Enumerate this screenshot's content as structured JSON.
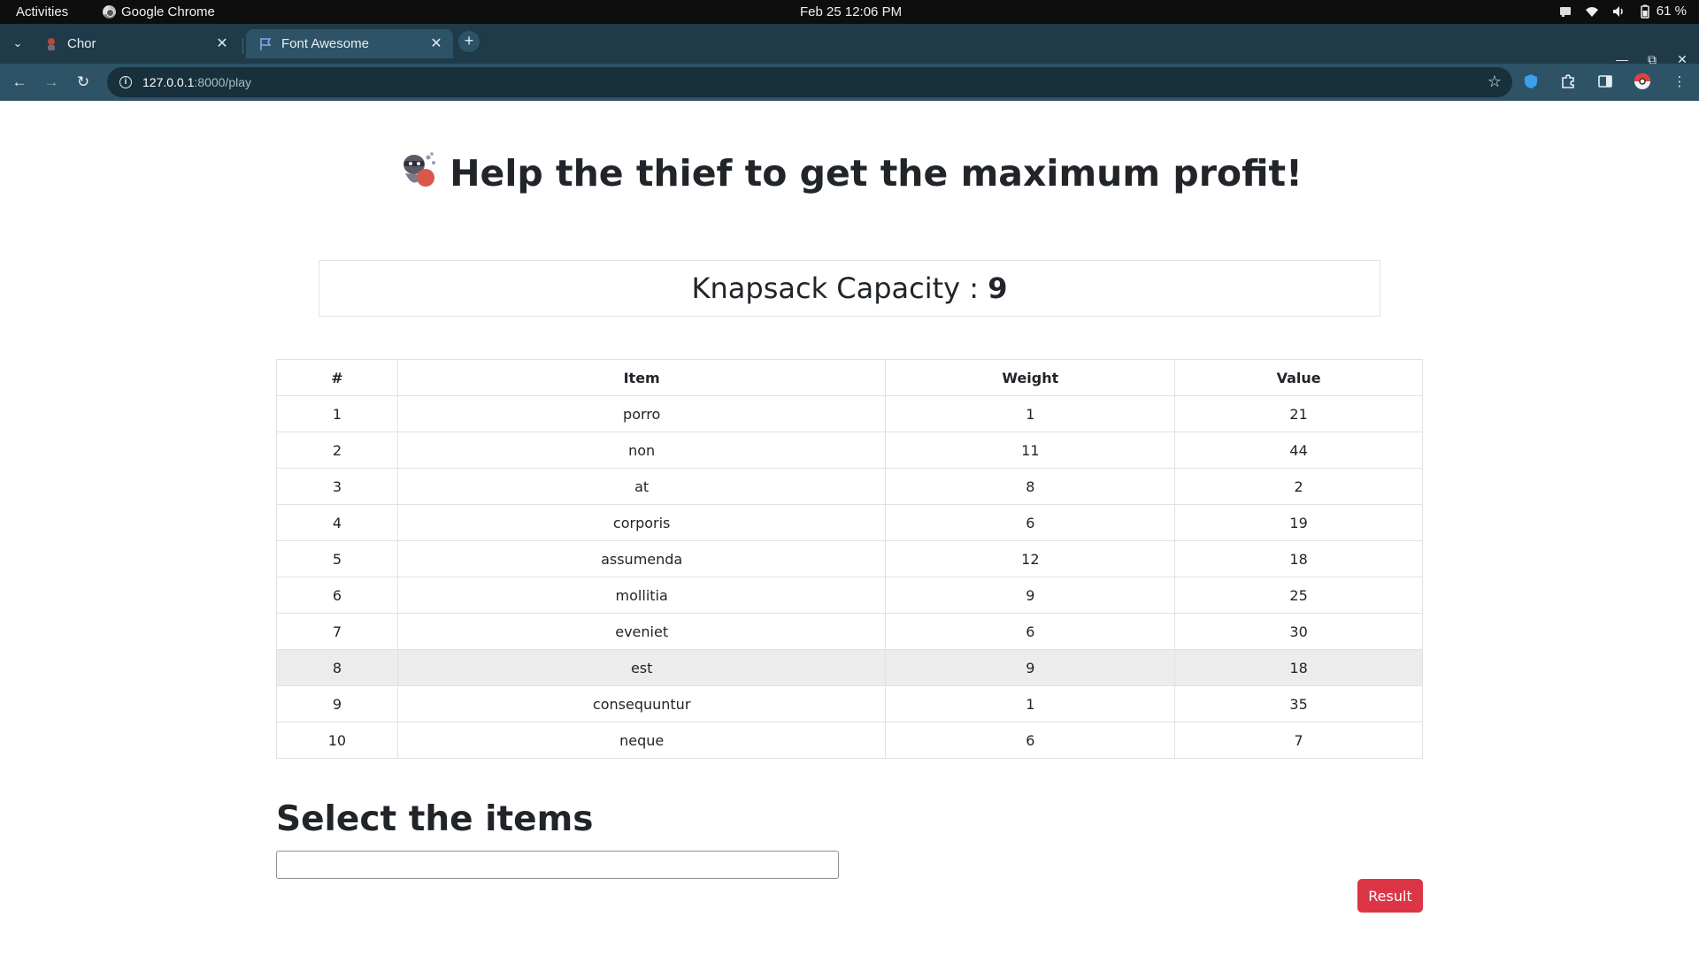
{
  "system": {
    "activities": "Activities",
    "app_name": "Google Chrome",
    "clock": "Feb 25  12:06 PM",
    "battery": "61 %"
  },
  "browser": {
    "tabs": [
      {
        "label": "Chor",
        "icon": "thief-favicon-icon"
      },
      {
        "label": "Font Awesome",
        "icon": "flag-icon"
      }
    ],
    "url_host": "127.0.0.1",
    "url_path": ":8000/play"
  },
  "page": {
    "title": "Help the thief to get the maximum profit!",
    "capacity_label": "Knapsack Capacity : ",
    "capacity_value": "9",
    "table": {
      "headers": [
        "#",
        "Item",
        "Weight",
        "Value"
      ],
      "rows": [
        [
          "1",
          "porro",
          "1",
          "21"
        ],
        [
          "2",
          "non",
          "11",
          "44"
        ],
        [
          "3",
          "at",
          "8",
          "2"
        ],
        [
          "4",
          "corporis",
          "6",
          "19"
        ],
        [
          "5",
          "assumenda",
          "12",
          "18"
        ],
        [
          "6",
          "mollitia",
          "9",
          "25"
        ],
        [
          "7",
          "eveniet",
          "6",
          "30"
        ],
        [
          "8",
          "est",
          "9",
          "18"
        ],
        [
          "9",
          "consequuntur",
          "1",
          "35"
        ],
        [
          "10",
          "neque",
          "6",
          "7"
        ]
      ],
      "highlighted_row": 8
    },
    "select_title": "Select the items",
    "select_input_value": "",
    "result_button": "Result"
  },
  "colors": {
    "accent_red": "#dc3545",
    "tabstrip": "#1f3a48",
    "toolbar": "#2e5366"
  }
}
